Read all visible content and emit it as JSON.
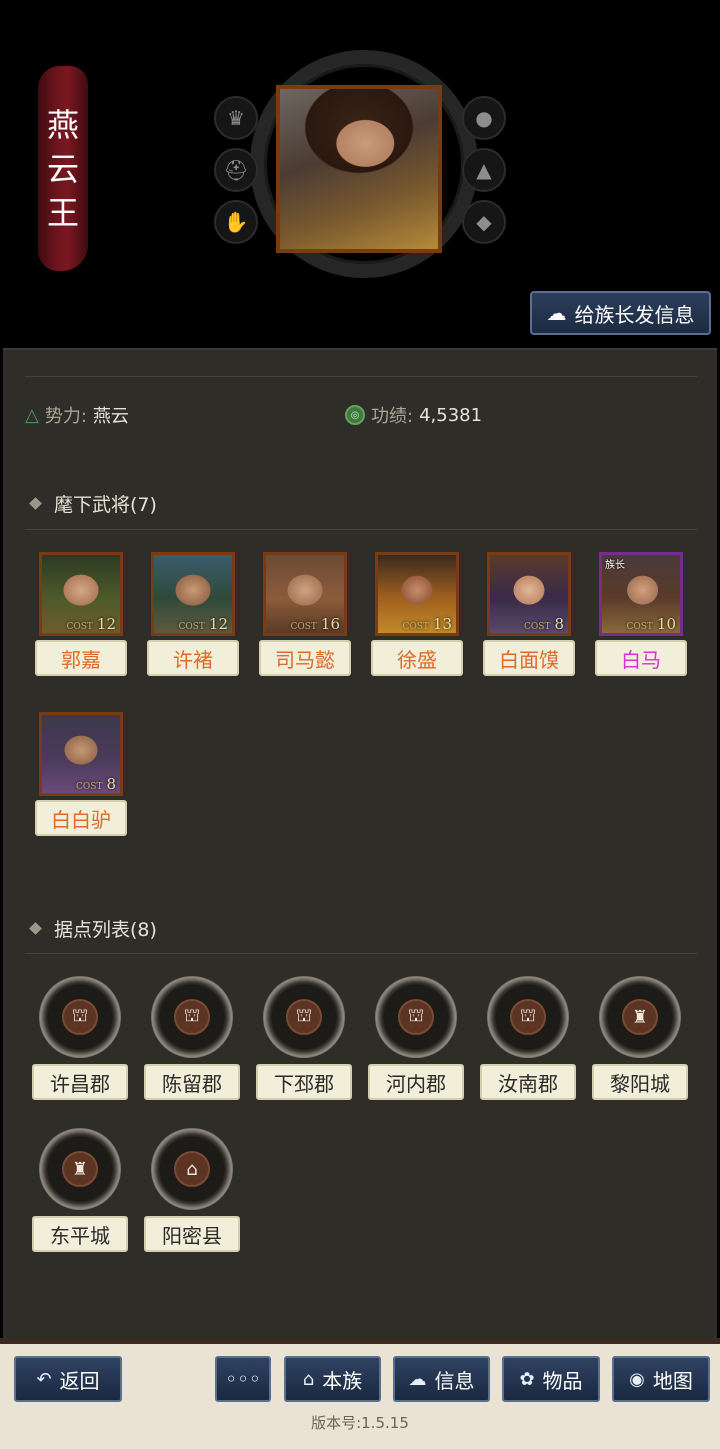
{
  "header": {
    "title_chars": [
      "燕",
      "云",
      "王"
    ],
    "clan_message_button": "给族长发信息",
    "left_icons": [
      "crown-icon",
      "helmet-icon",
      "handshake-icon"
    ],
    "right_icons": [
      "hand-coin-icon",
      "hat-icon",
      "scholar-cap-icon"
    ]
  },
  "info": {
    "faction_label": "势力:",
    "faction_value": "燕云",
    "merit_label": "功绩:",
    "merit_value": "4,5381"
  },
  "generals_section": {
    "title": "麾下武将(7)",
    "cost_label": "COST",
    "items": [
      {
        "name": "郭嘉",
        "cost": "12",
        "tag": ""
      },
      {
        "name": "许褚",
        "cost": "12",
        "tag": ""
      },
      {
        "name": "司马懿",
        "cost": "16",
        "tag": ""
      },
      {
        "name": "徐盛",
        "cost": "13",
        "tag": ""
      },
      {
        "name": "白面馍",
        "cost": "8",
        "tag": ""
      },
      {
        "name": "白马",
        "cost": "10",
        "tag": "族长"
      },
      {
        "name": "白白驴",
        "cost": "8",
        "tag": ""
      }
    ]
  },
  "strongholds_section": {
    "title": "据点列表(8)",
    "items": [
      {
        "name": "许昌郡"
      },
      {
        "name": "陈留郡"
      },
      {
        "name": "下邳郡"
      },
      {
        "name": "河内郡"
      },
      {
        "name": "汝南郡"
      },
      {
        "name": "黎阳城"
      },
      {
        "name": "东平城"
      },
      {
        "name": "阳密县"
      }
    ]
  },
  "bottom_bar": {
    "back": "返回",
    "more": "◦◦◦",
    "clan": "本族",
    "message": "信息",
    "items": "物品",
    "map": "地图",
    "version": "版本号:1.5.15"
  },
  "colors": {
    "general_name": "#e06a28",
    "leader_name": "#d633d6",
    "button_bg": "#1b2940"
  }
}
